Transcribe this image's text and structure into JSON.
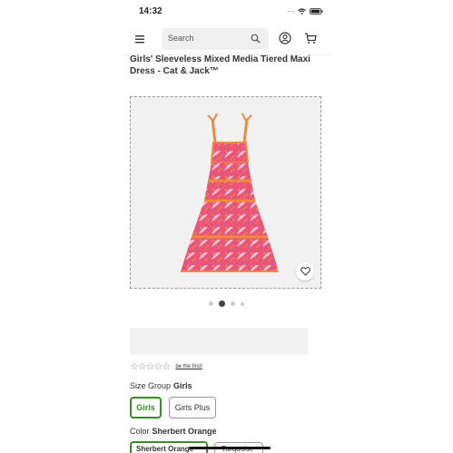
{
  "status_bar": {
    "time": "14:32"
  },
  "header": {
    "search_placeholder": "Search"
  },
  "product": {
    "title": "Girls' Sleeveless Mixed Media Tiered Maxi Dress - Cat & Jack™",
    "image_alt_icon": "dress-image",
    "carousel": {
      "count": 4,
      "active_index": 1
    },
    "rating": {
      "stars": "☆☆☆☆☆",
      "link": "be the first!"
    },
    "size_group": {
      "label": "Size Group",
      "selected": "Girls",
      "options": [
        "Girls",
        "Girls Plus"
      ]
    },
    "color": {
      "label": "Color",
      "selected": "Sherbert Orange",
      "options": [
        "Sherbert Orange",
        "Turquoise"
      ]
    }
  },
  "colors": {
    "accent": "#3a8a2e",
    "dress_pink": "#e8567a",
    "dress_orange": "#f08a3c"
  }
}
